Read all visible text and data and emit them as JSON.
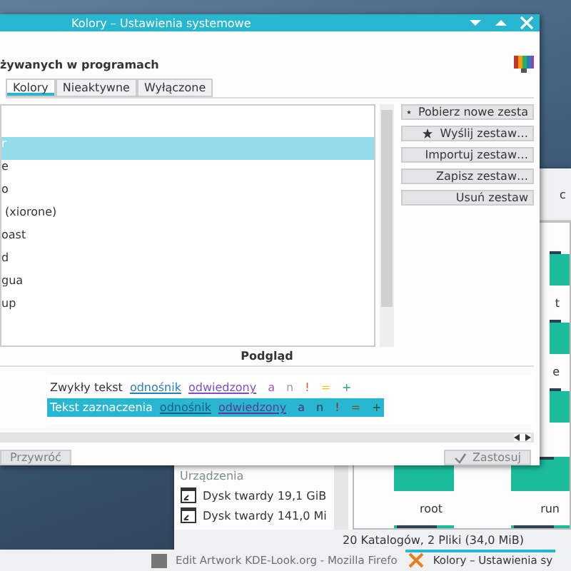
{
  "window": {
    "title": "Kolory – Ustawienia systemowe",
    "heading": "żywanych w programach"
  },
  "tabs": [
    {
      "label": "Kolory",
      "selected": true
    },
    {
      "label": "Nieaktywne",
      "selected": false
    },
    {
      "label": "Wyłączone",
      "selected": false
    }
  ],
  "schemes": [
    {
      "name": "r",
      "selected": true
    },
    {
      "name": "e",
      "selected": false
    },
    {
      "name": "o",
      "selected": false
    },
    {
      "name": " (xiorone)",
      "selected": false
    },
    {
      "name": "oast",
      "selected": false
    },
    {
      "name": "d",
      "selected": false
    },
    {
      "name": "gua",
      "selected": false
    },
    {
      "name": "up",
      "selected": false
    }
  ],
  "scheme_buttons": [
    {
      "label": "Pobierz nowe zesta",
      "kind": "star"
    },
    {
      "label": "Wyślij zestaw…",
      "kind": "star"
    },
    {
      "label": "Importuj zestaw…",
      "kind": "plain"
    },
    {
      "label": "Zapisz zestaw…",
      "kind": "plain"
    },
    {
      "label": "Usuń zestaw",
      "kind": "plain"
    }
  ],
  "preview": {
    "title": "Podgląd",
    "rows": [
      {
        "kind": "normal",
        "label": "Zwykły tekst",
        "link": "odnośnik",
        "visited": "odwiedzony",
        "marks": [
          {
            "text": "a",
            "color": "#9b59b6"
          },
          {
            "text": "n",
            "color": "#9aa1a6"
          },
          {
            "text": "!",
            "color": "#e74c3c"
          },
          {
            "text": "=",
            "color": "#f1c40f"
          },
          {
            "text": "+",
            "color": "#27ae60"
          }
        ]
      },
      {
        "kind": "selection",
        "label": "Tekst zaznaczenia",
        "link": "odnośnik",
        "visited": "odwiedzony",
        "marks": [
          {
            "text": "a",
            "color": "#5b2c6f"
          },
          {
            "text": "n",
            "color": "#2c3e50"
          },
          {
            "text": "!",
            "color": "#922b21"
          },
          {
            "text": "=",
            "color": "#6e5a07"
          },
          {
            "text": "+",
            "color": "#145a32"
          }
        ]
      }
    ]
  },
  "footer": {
    "reset": {
      "label": "Przywróć",
      "disabled": true
    },
    "apply": {
      "label": "Zastosuj",
      "disabled": true
    }
  },
  "file_manager": {
    "path": "c",
    "places_heading": "Urządzenia",
    "devices": [
      {
        "label": "Dysk twardy 19,1 GiB"
      },
      {
        "label": "Dysk twardy 141,0 Mi"
      }
    ],
    "folders": [
      {
        "kind": "folder-edge",
        "name": "t"
      },
      {
        "kind": "folder-edge",
        "name": "e"
      },
      {
        "kind": "folder-edge"
      },
      {
        "kind": "folder",
        "name": "root"
      },
      {
        "kind": "folder",
        "name": "run"
      },
      {
        "kind": "folder"
      },
      {
        "kind": "folder"
      }
    ],
    "status": "20 Katalogów, 2 Pliki (34,0 MiB)"
  },
  "taskbar": [
    {
      "label": "Edit  Artwork KDE-Look.org - Mozilla Firefo",
      "selected": false
    },
    {
      "label": "Kolory – Ustawienia sy",
      "selected": true
    }
  ]
}
